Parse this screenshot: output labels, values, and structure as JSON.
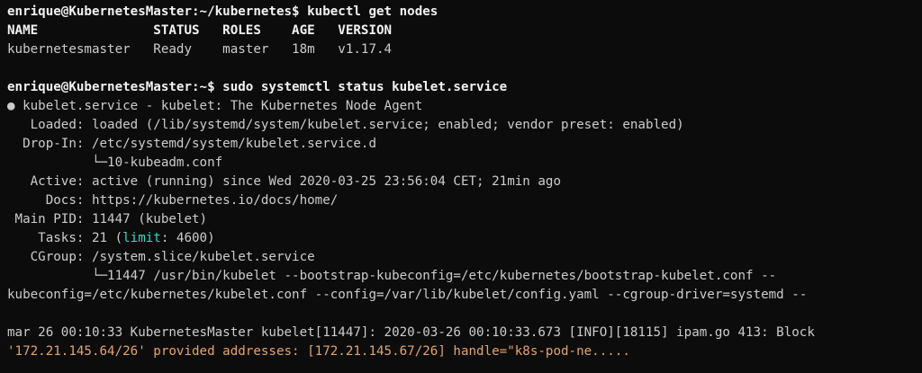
{
  "prompt1": "enrique@KubernetesMaster:~/kubernetes$ kubectl get nodes",
  "nodes_header": "NAME               STATUS   ROLES    AGE   VERSION",
  "nodes_row": "kubernetesmaster   Ready    master   18m   v1.17.4",
  "prompt2": "enrique@KubernetesMaster:~$ sudo systemctl status kubelet.service",
  "unit_title": "● kubelet.service - kubelet: The Kubernetes Node Agent",
  "loaded": "   Loaded: loaded (/lib/systemd/system/kubelet.service; enabled; vendor preset: enabled)",
  "dropin": "  Drop-In: /etc/systemd/system/kubelet.service.d",
  "dropin_file": "           └─10-kubeadm.conf",
  "active": "   Active: active (running) since Wed 2020-03-25 23:56:04 CET; 21min ago",
  "docs": "     Docs: https://kubernetes.io/docs/home/",
  "mainpid": " Main PID: 11447 (kubelet)",
  "tasks_prefix": "    Tasks: 21 (",
  "tasks_limit_word": "limit",
  "tasks_suffix": ": 4600)",
  "cgroup": "   CGroup: /system.slice/kubelet.service",
  "cgroup_proc": "           └─11447 /usr/bin/kubelet --bootstrap-kubeconfig=/etc/kubernetes/bootstrap-kubelet.conf --",
  "cgroup_proc_cont": "kubeconfig=/etc/kubernetes/kubelet.conf --config=/var/lib/kubelet/config.yaml --cgroup-driver=systemd --",
  "log_line1": "mar 26 00:10:33 KubernetesMaster kubelet[11447]: 2020-03-26 00:10:33.673 [INFO][18115] ipam.go 413: Block",
  "log_line2": "'172.21.145.64/26' provided addresses: [172.21.145.67/26] handle=\"k8s-pod-ne.....",
  "colors": {
    "background": "#0c0c0c",
    "text": "#cccccc",
    "bold": "#f2f2f2",
    "highlight": "#3bd6c6",
    "log_warning": "#e5a46a"
  }
}
